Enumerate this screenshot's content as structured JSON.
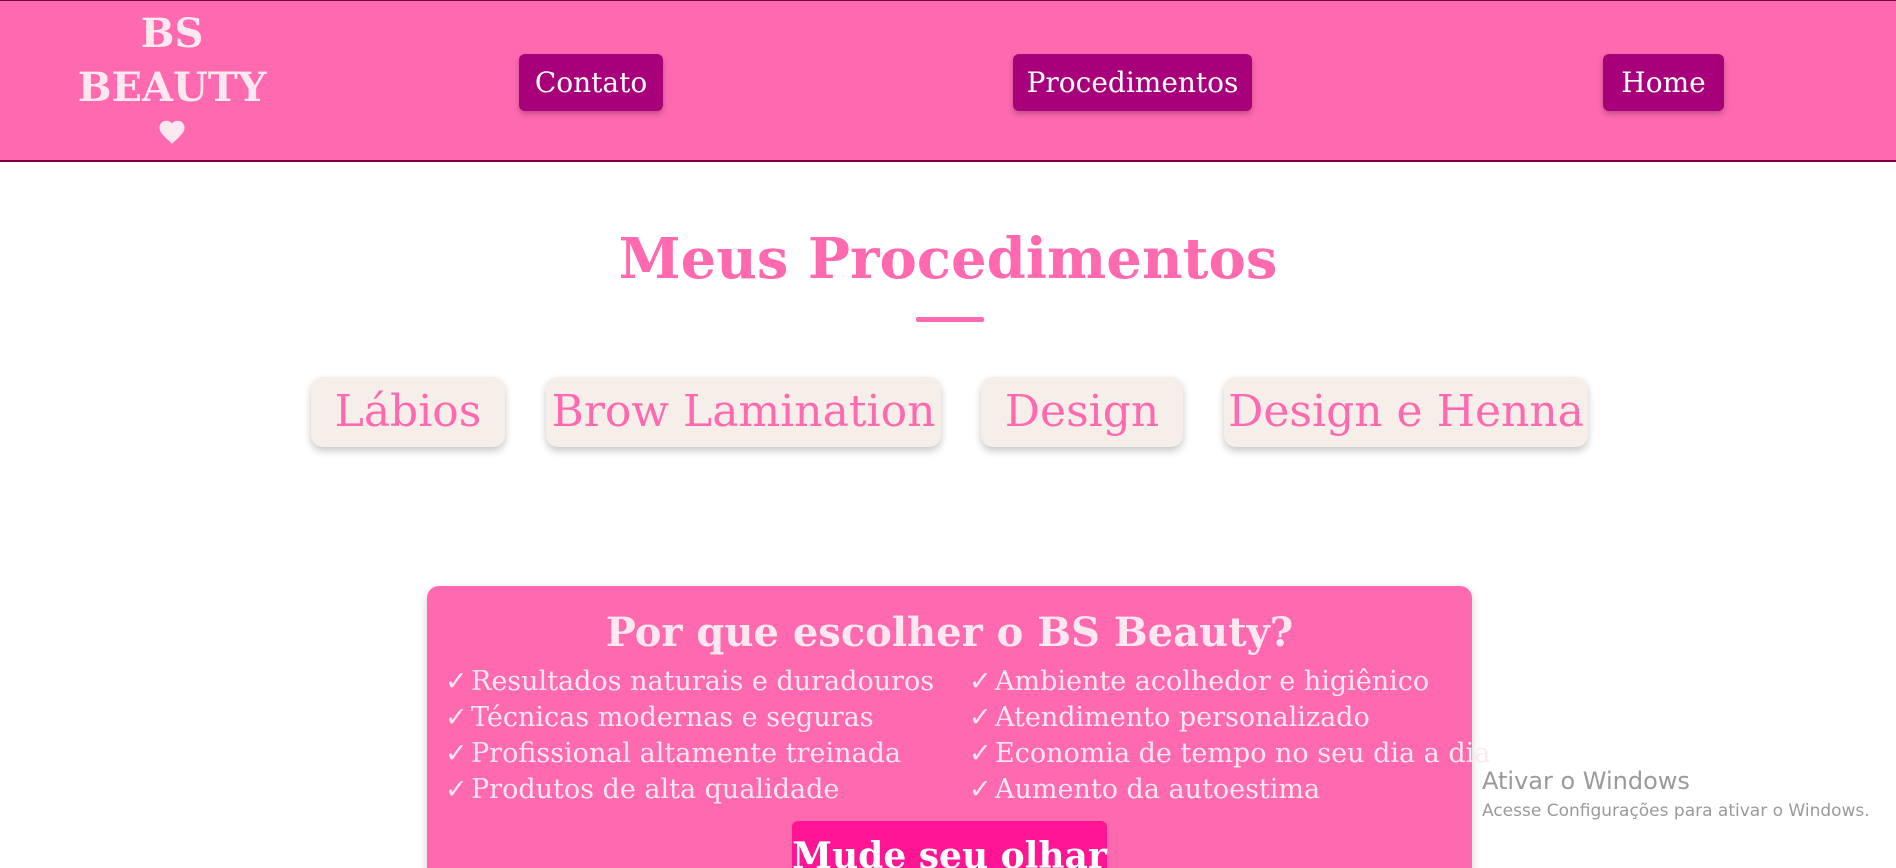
{
  "header": {
    "logo_line1": "BS",
    "logo_line2": "BEAUTY",
    "logo_icon": "heart-icon",
    "nav": {
      "contato": "Contato",
      "procedimentos": "Procedimentos",
      "home": "Home"
    }
  },
  "procedures": {
    "title": "Meus Procedimentos",
    "items": [
      "Lábios",
      "Brow Lamination",
      "Design",
      "Design e Henna"
    ]
  },
  "why": {
    "title": "Por que escolher o BS Beauty?",
    "check_glyph": "✓",
    "left_items": [
      "Resultados naturais e duradouros",
      "Técnicas modernas e seguras",
      "Profissional altamente treinada",
      "Produtos de alta qualidade"
    ],
    "right_items": [
      "Ambiente acolhedor e higiênico",
      "Atendimento personalizado",
      "Economia de tempo no seu dia a dia",
      "Aumento da autoestima"
    ],
    "cta_label": "Mude seu olhar"
  },
  "watermark": {
    "title": "Ativar o Windows",
    "subtitle": "Acesse Configurações para ativar o Windows."
  },
  "colors": {
    "brand_pink": "#ff69b0",
    "nav_button": "#a8007a",
    "card_bg": "#f6eee9",
    "cta": "#ff1493",
    "light_text": "#fde8ef"
  }
}
